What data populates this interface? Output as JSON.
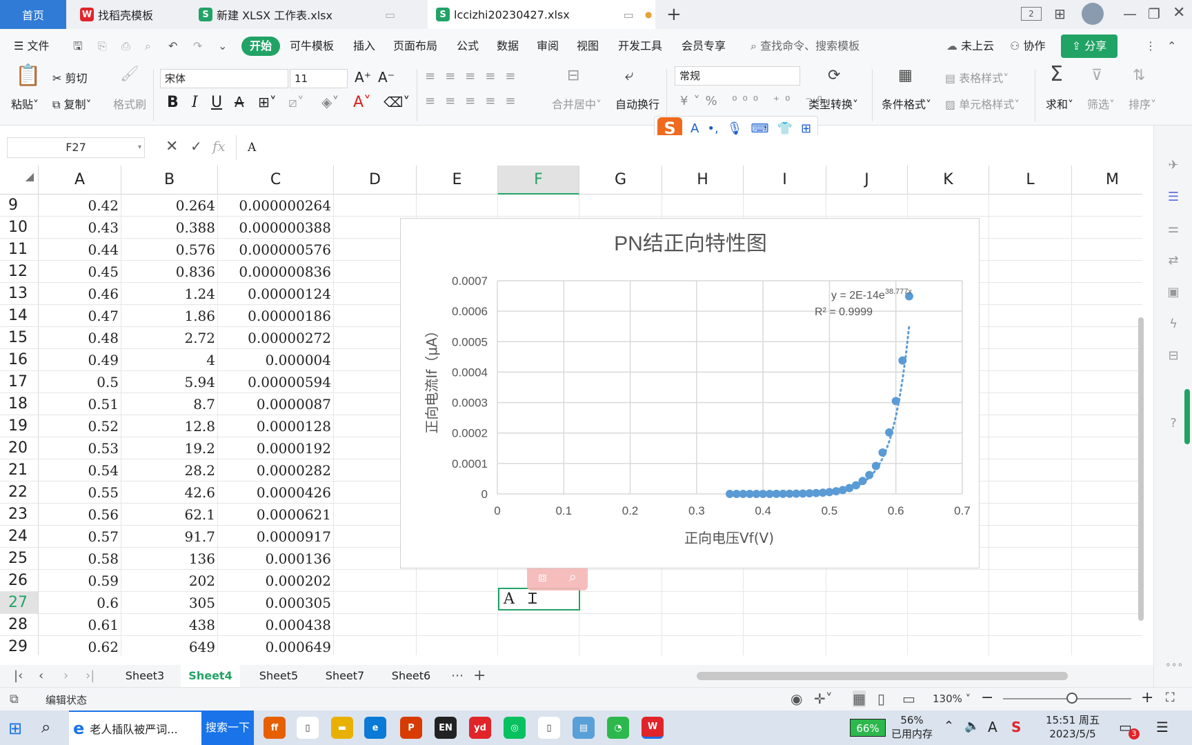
{
  "doc_tabs": {
    "home": "首页",
    "tab1": "找稻壳模板",
    "tab2": "新建 XLSX 工作表.xlsx",
    "tab3": "lccizhi20230427.xlsx",
    "add": "+"
  },
  "menu": {
    "file": "文件",
    "start": "开始",
    "template": "可牛模板",
    "insert": "插入",
    "layout": "页面布局",
    "formula": "公式",
    "data": "数据",
    "review": "审阅",
    "view": "视图",
    "dev": "开发工具",
    "member": "会员专享",
    "search_placeholder": "查找命令、搜索模板",
    "cloud": "未上云",
    "collab": "协作",
    "share": "分享"
  },
  "ribbon": {
    "paste": "粘贴",
    "cut": "剪切",
    "copy": "复制",
    "format_painter": "格式刷",
    "font_name": "宋体",
    "font_size": "11",
    "merge": "合并居中",
    "wrap": "自动换行",
    "number_format": "常规",
    "convert": "类型转换",
    "cond_format": "条件格式",
    "table_style": "表格样式",
    "cell_style": "单元格样式",
    "sum": "求和",
    "filter": "筛选",
    "sort": "排序",
    "bold": "B",
    "italic": "I",
    "underline": "U"
  },
  "formula_bar": {
    "name_box": "F27",
    "fx": "fx",
    "content": "A"
  },
  "columns": [
    "A",
    "B",
    "C",
    "D",
    "E",
    "F",
    "G",
    "H",
    "I",
    "J",
    "K",
    "L",
    "M"
  ],
  "rows": [
    {
      "n": "9",
      "a": "0.42",
      "b": "0.264",
      "c": "0.000000264"
    },
    {
      "n": "10",
      "a": "0.43",
      "b": "0.388",
      "c": "0.000000388"
    },
    {
      "n": "11",
      "a": "0.44",
      "b": "0.576",
      "c": "0.000000576"
    },
    {
      "n": "12",
      "a": "0.45",
      "b": "0.836",
      "c": "0.000000836"
    },
    {
      "n": "13",
      "a": "0.46",
      "b": "1.24",
      "c": "0.00000124"
    },
    {
      "n": "14",
      "a": "0.47",
      "b": "1.86",
      "c": "0.00000186"
    },
    {
      "n": "15",
      "a": "0.48",
      "b": "2.72",
      "c": "0.00000272"
    },
    {
      "n": "16",
      "a": "0.49",
      "b": "4",
      "c": "0.000004"
    },
    {
      "n": "17",
      "a": "0.5",
      "b": "5.94",
      "c": "0.00000594"
    },
    {
      "n": "18",
      "a": "0.51",
      "b": "8.7",
      "c": "0.0000087"
    },
    {
      "n": "19",
      "a": "0.52",
      "b": "12.8",
      "c": "0.0000128"
    },
    {
      "n": "20",
      "a": "0.53",
      "b": "19.2",
      "c": "0.0000192"
    },
    {
      "n": "21",
      "a": "0.54",
      "b": "28.2",
      "c": "0.0000282"
    },
    {
      "n": "22",
      "a": "0.55",
      "b": "42.6",
      "c": "0.0000426"
    },
    {
      "n": "23",
      "a": "0.56",
      "b": "62.1",
      "c": "0.0000621"
    },
    {
      "n": "24",
      "a": "0.57",
      "b": "91.7",
      "c": "0.0000917"
    },
    {
      "n": "25",
      "a": "0.58",
      "b": "136",
      "c": "0.000136"
    },
    {
      "n": "26",
      "a": "0.59",
      "b": "202",
      "c": "0.000202"
    },
    {
      "n": "27",
      "a": "0.6",
      "b": "305",
      "c": "0.000305"
    },
    {
      "n": "28",
      "a": "0.61",
      "b": "438",
      "c": "0.000438"
    },
    {
      "n": "29",
      "a": "0.62",
      "b": "649",
      "c": "0.000649"
    }
  ],
  "active_cell_text": "A",
  "chart_data": {
    "type": "scatter",
    "title": "PN结正向特性图",
    "xlabel": "正向电压Vf(V)",
    "ylabel": "正向电流If（μA）",
    "xlim": [
      0,
      0.7
    ],
    "ylim": [
      0,
      0.0007
    ],
    "xticks": [
      "0",
      "0.1",
      "0.2",
      "0.3",
      "0.4",
      "0.5",
      "0.6",
      "0.7"
    ],
    "yticks": [
      "0",
      "0.0001",
      "0.0002",
      "0.0003",
      "0.0004",
      "0.0005",
      "0.0006",
      "0.0007"
    ],
    "grid": true,
    "trendline": "exponential",
    "equation_prefix": "y = 2E-14e",
    "equation_exp": "38.777x",
    "r2": "R² = 0.9999",
    "x": [
      0.35,
      0.36,
      0.37,
      0.38,
      0.39,
      0.4,
      0.41,
      0.42,
      0.43,
      0.44,
      0.45,
      0.46,
      0.47,
      0.48,
      0.49,
      0.5,
      0.51,
      0.52,
      0.53,
      0.54,
      0.55,
      0.56,
      0.57,
      0.58,
      0.59,
      0.6,
      0.61,
      0.62
    ],
    "y": [
      3e-10,
      5e-10,
      8e-10,
      1.2e-09,
      1.8e-09,
      3e-09,
      4.5e-09,
      2.64e-07,
      3.88e-07,
      5.76e-07,
      8.36e-07,
      1.24e-06,
      1.86e-06,
      2.72e-06,
      4e-06,
      5.94e-06,
      8.7e-06,
      1.28e-05,
      1.92e-05,
      2.82e-05,
      4.26e-05,
      6.21e-05,
      9.17e-05,
      0.000136,
      0.000202,
      0.000305,
      0.000438,
      0.000649
    ],
    "color": "#5b9bd5"
  },
  "sheet_tabs": [
    "Sheet3",
    "Sheet4",
    "Sheet5",
    "Sheet7",
    "Sheet6"
  ],
  "status": {
    "mode": "编辑状态",
    "zoom": "130%"
  },
  "taskbar": {
    "browser_title": "老人插队被严词...",
    "search_btn": "搜索一下",
    "battery": "66%",
    "mem_pct": "56%",
    "mem_label": "已用内存",
    "ime": "A",
    "time": "15:51 周五",
    "date": "2023/5/5",
    "notif": "3"
  },
  "colors": {
    "accent": "#21a366",
    "home_tab": "#2f7bd6",
    "series": "#5b9bd5"
  }
}
